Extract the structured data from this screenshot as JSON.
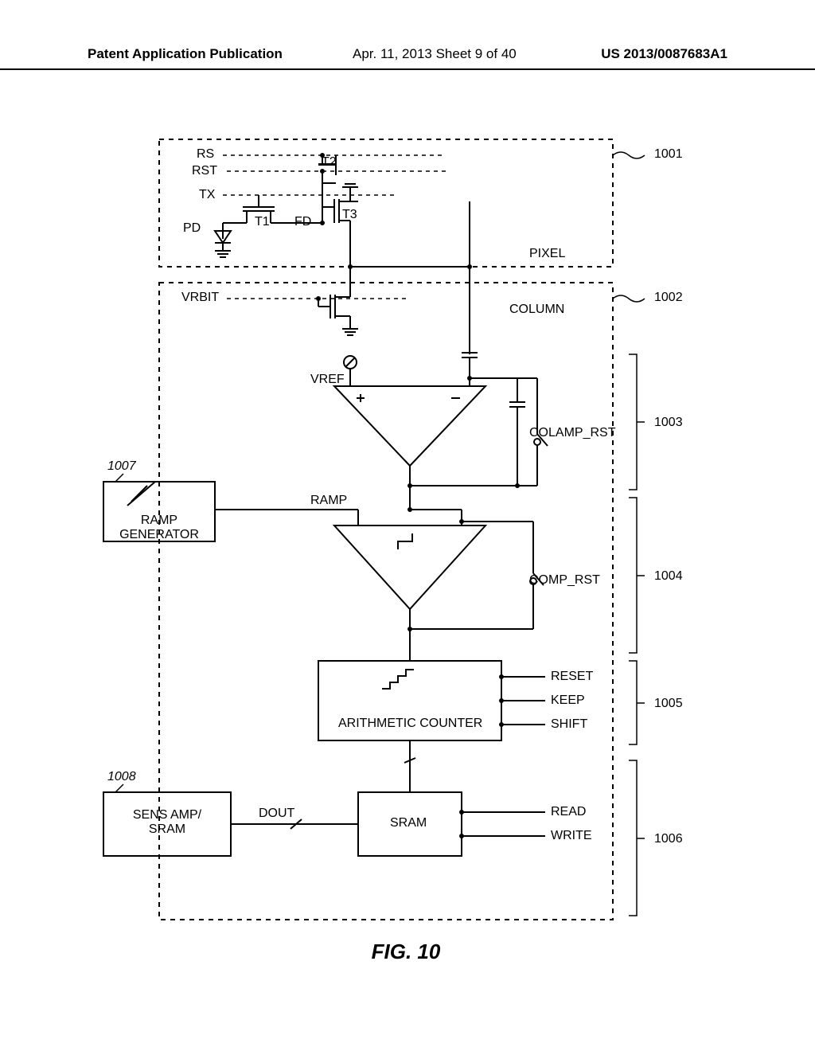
{
  "header": {
    "left": "Patent Application Publication",
    "mid": "Apr. 11, 2013  Sheet 9 of 40",
    "right": "US 2013/0087683A1"
  },
  "labels": {
    "rs": "RS",
    "rst": "RST",
    "tx": "TX",
    "pd": "PD",
    "t1": "T1",
    "t2": "T2",
    "t3": "T3",
    "fd": "FD",
    "pixel": "PIXEL",
    "vrbit": "VRBIT",
    "column": "COLUMN",
    "vref": "VREF",
    "colamp_rst": "COLAMP_RST",
    "ramp": "RAMP",
    "ramp_gen": "RAMP\nGENERATOR",
    "comp_rst": "COMP_RST",
    "arith": "ARITHMETIC COUNTER",
    "reset": "RESET",
    "keep": "KEEP",
    "shift": "SHIFT",
    "sram": "SRAM",
    "read": "READ",
    "write": "WRITE",
    "dout": "DOUT",
    "sensamp": "SENS AMP/\nSRAM"
  },
  "refs": {
    "r1001": "1001",
    "r1002": "1002",
    "r1003": "1003",
    "r1004": "1004",
    "r1005": "1005",
    "r1006": "1006",
    "r1007": "1007",
    "r1008": "1008"
  },
  "figure_title": "FIG. 10"
}
